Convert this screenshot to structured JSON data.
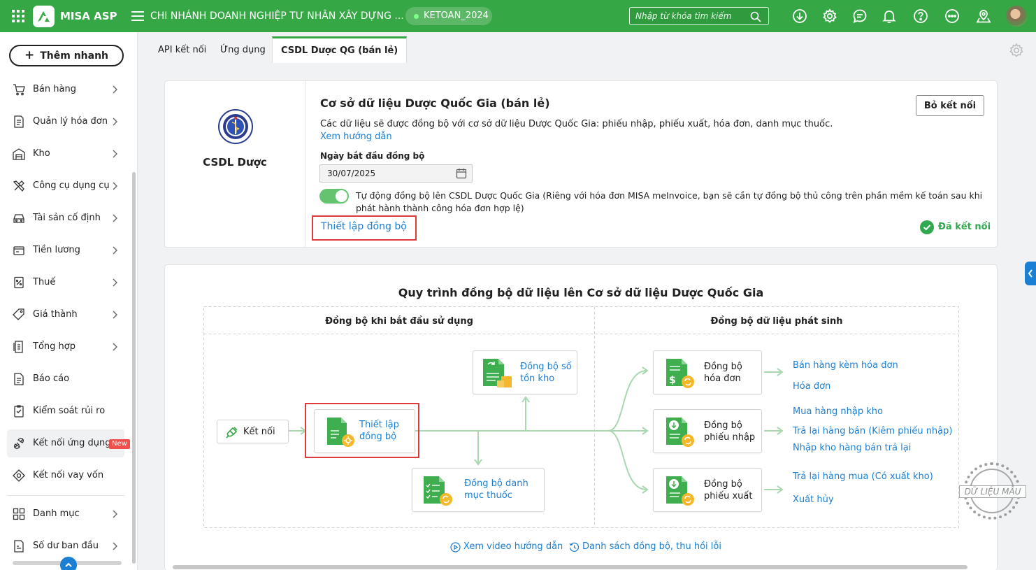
{
  "app": {
    "brand": "MISA ASP",
    "branch": "CHI NHÁNH DOANH NGHIỆP TƯ NHÂN XÂY DỰNG ...",
    "db_chip": "KETOAN_2024",
    "search_placeholder": "Nhập từ khóa tìm kiếm"
  },
  "sidebar": {
    "quick_add": "Thêm nhanh",
    "items": [
      {
        "label": "Bán hàng",
        "icon": "cart-icon"
      },
      {
        "label": "Quản lý hóa đơn",
        "icon": "invoice-icon"
      },
      {
        "label": "Kho",
        "icon": "warehouse-icon"
      },
      {
        "label": "Công cụ dụng cụ",
        "icon": "tools-icon"
      },
      {
        "label": "Tài sản cố định",
        "icon": "car-icon"
      },
      {
        "label": "Tiền lương",
        "icon": "salary-icon"
      },
      {
        "label": "Thuế",
        "icon": "tax-icon"
      },
      {
        "label": "Giá thành",
        "icon": "price-tag-icon"
      },
      {
        "label": "Tổng hợp",
        "icon": "summary-icon"
      },
      {
        "label": "Báo cáo",
        "icon": "report-icon"
      },
      {
        "label": "Kiểm soát rủi ro",
        "icon": "risk-icon"
      },
      {
        "label": "Kết nối ứng dụng",
        "icon": "connect-icon",
        "badge": "New"
      },
      {
        "label": "Kết nối vay vốn",
        "icon": "loan-icon"
      },
      {
        "label": "Danh mục",
        "icon": "grid-icon"
      },
      {
        "label": "Số dư ban đầu",
        "icon": "balance-icon"
      }
    ]
  },
  "tabs": [
    "API kết nối",
    "Ứng dụng",
    "CSDL Dược QG (bán lẻ)"
  ],
  "connect_card": {
    "logo_label": "CSDL Dược",
    "title": "Cơ sở dữ liệu Dược Quốc Gia (bán lẻ)",
    "description": "Các dữ liệu sẽ được đồng bộ với cơ sở dữ liệu Dược Quốc Gia: phiếu nhập, phiếu xuất, hóa đơn, danh mục thuốc.",
    "guide_link": "Xem hướng dẫn",
    "date_label": "Ngày bắt đầu đồng bộ",
    "date_value": "30/07/2025",
    "auto_sync_text_1": "Tự động đồng bộ lên CSDL Dược Quốc Gia (Riêng với hóa đơn MISA meInvoice, bạn sẽ cần tự đồng bộ thủ công trên phần mềm kế toán sau khi",
    "auto_sync_text_2": "phát hành thành công hóa đơn hợp lệ)",
    "setup_link": "Thiết lập đồng bộ",
    "disconnect_button": "Bỏ kết nối",
    "status": "Đã kết nối"
  },
  "flow": {
    "title": "Quy trình đồng bộ dữ liệu lên Cơ sở dữ liệu Dược Quốc Gia",
    "col_left": "Đồng bộ khi bắt đầu sử dụng",
    "col_right": "Đồng bộ dữ liệu phát sinh",
    "connect": "Kết nối",
    "setup_1": "Thiết lập",
    "setup_2": "đồng bộ",
    "stock_1": "Đồng bộ số",
    "stock_2": "tồn kho",
    "catalog_1": "Đồng bộ danh",
    "catalog_2": "mục thuốc",
    "invoice_1": "Đồng bộ",
    "invoice_2": "hóa đơn",
    "import_1": "Đồng bộ",
    "import_2": "phiếu nhập",
    "export_1": "Đồng bộ",
    "export_2": "phiếu xuất",
    "links": [
      "Bán hàng kèm hóa đơn",
      "Hóa đơn",
      "Mua hàng nhập kho",
      "Trả lại hàng bán (Kiêm phiếu nhập)",
      "Nhập kho hàng bán trả lại",
      "Trả lại hàng mua (Có xuất kho)",
      "Xuất hủy"
    ],
    "video_link": "Xem video hướng dẫn",
    "error_link": "Danh sách đồng bộ, thu hồi lỗi"
  },
  "stamp": "DỮ LIỆU MẪU",
  "colors": {
    "brand_green": "#35a845",
    "link_blue": "#1b7fd4",
    "highlight_red": "#e03b3b"
  }
}
